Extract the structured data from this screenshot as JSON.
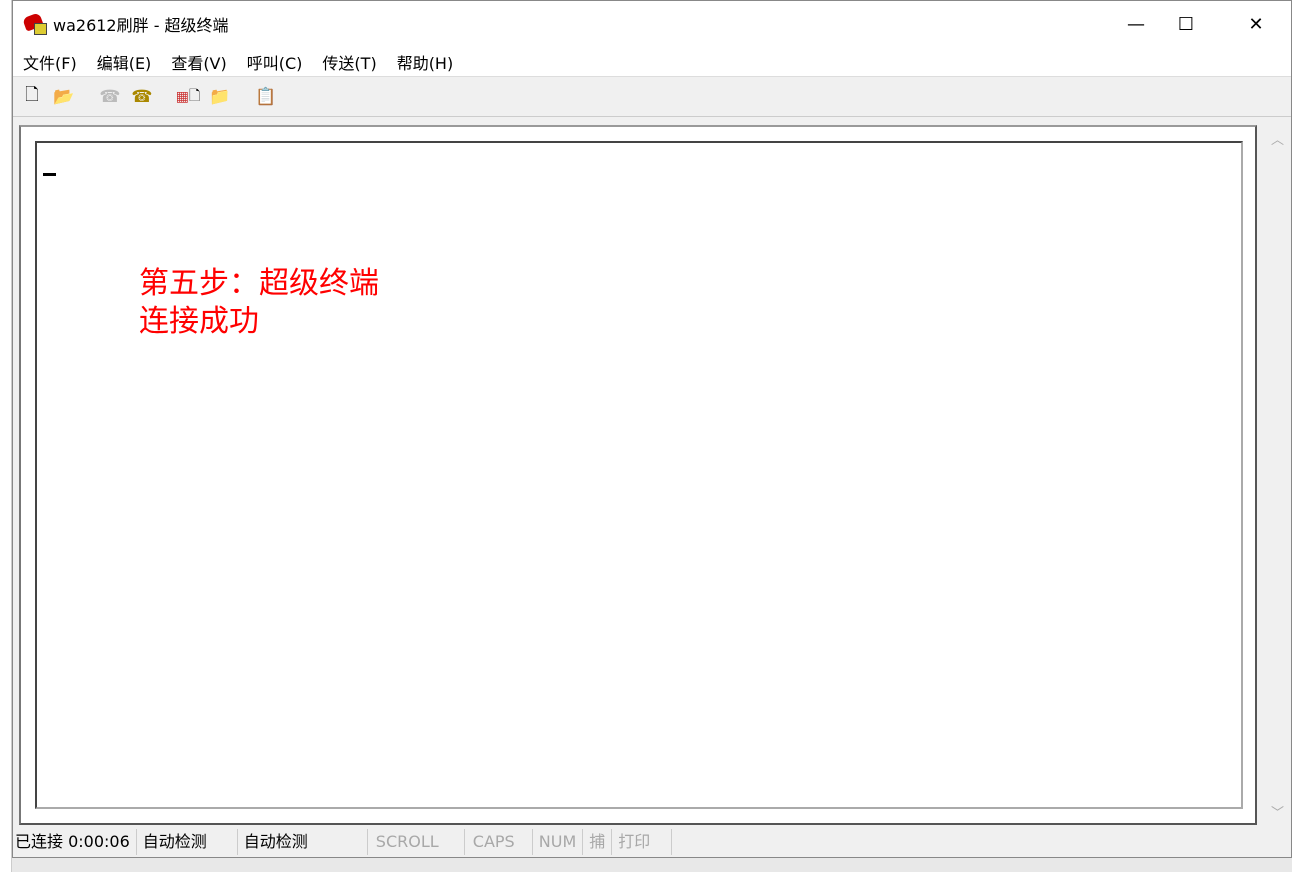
{
  "window": {
    "title": "wa2612刷胖 - 超级终端",
    "minimize": "—",
    "maximize": "☐",
    "close": "✕"
  },
  "menu": [
    "文件(F)",
    "编辑(E)",
    "查看(V)",
    "呼叫(C)",
    "传送(T)",
    "帮助(H)"
  ],
  "toolbar": [
    "new-icon",
    "open-icon",
    "disconnect-icon",
    "call-icon",
    "send-icon",
    "receive-icon",
    "properties-icon"
  ],
  "terminal": {
    "annotation_line1": "第五步：超级终端",
    "annotation_line2": "连接成功",
    "annotation_color": "#ff0000"
  },
  "status": {
    "connection": "已连接 0:00:06",
    "detect1": "自动检测",
    "detect2": "自动检测",
    "scroll": "SCROLL",
    "caps": "CAPS",
    "num": "NUM",
    "capture": "捕",
    "print": "打印"
  }
}
